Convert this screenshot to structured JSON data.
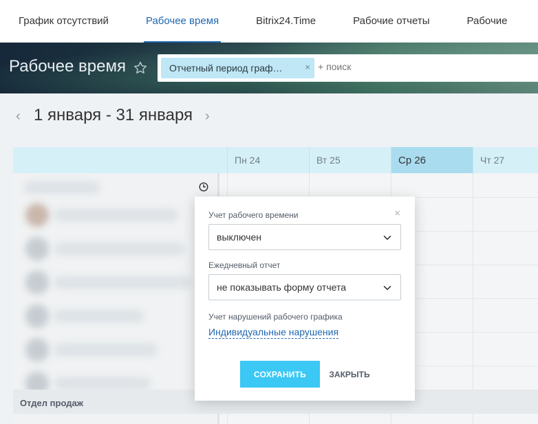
{
  "tabs": [
    {
      "label": "График отсутствий",
      "active": false
    },
    {
      "label": "Рабочее время",
      "active": true
    },
    {
      "label": "Bitrix24.Time",
      "active": false
    },
    {
      "label": "Рабочие отчеты",
      "active": false
    },
    {
      "label": "Рабочие",
      "active": false
    }
  ],
  "header": {
    "title": "Рабочее время",
    "filter_tag": "Отчетный период граф…",
    "filter_tag_remove": "×",
    "search_placeholder": "+ поиск"
  },
  "period": {
    "label": "1 января - 31 января",
    "prev": "‹",
    "next": "›"
  },
  "grid": {
    "days": [
      {
        "label": "Пн 24",
        "today": false
      },
      {
        "label": "Вт 25",
        "today": false
      },
      {
        "label": "Ср 26",
        "today": true
      },
      {
        "label": "Чт 27",
        "today": false
      }
    ],
    "department": "Отдел продаж"
  },
  "popup": {
    "close": "×",
    "timetracking_label": "Учет рабочего времени",
    "timetracking_value": "выключен",
    "daily_report_label": "Ежедневный отчет",
    "daily_report_value": "не показывать форму отчета",
    "violations_label": "Учет нарушений рабочего графика",
    "violations_link": "Индивидуальные нарушения",
    "save_label": "СОХРАНИТЬ",
    "close_label": "ЗАКРЫТЬ"
  },
  "colors": {
    "accent": "#2067b0",
    "save_button": "#3bc8f5",
    "filter_tag": "#bfe7f5",
    "today_column": "#a9dcef"
  },
  "icons": [
    "star-icon",
    "clock-icon",
    "chevron-down-icon",
    "close-icon",
    "arrow-left-icon",
    "arrow-right-icon"
  ]
}
